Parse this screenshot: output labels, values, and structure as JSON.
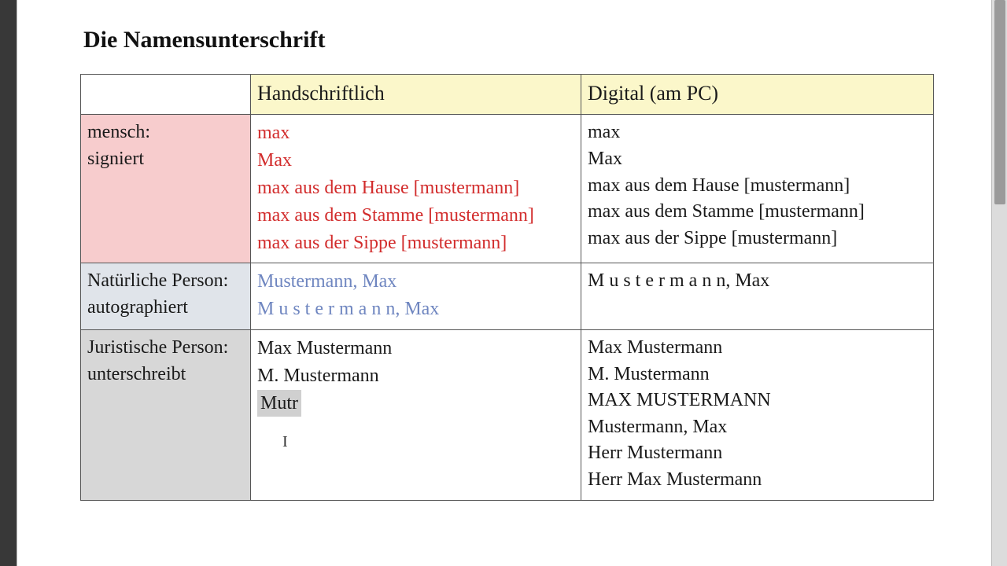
{
  "title": "Die Namensunterschrift",
  "headers": {
    "blank": "",
    "hand": "Handschriftlich",
    "digital": "Digital (am PC)"
  },
  "rows": {
    "mensch": {
      "label_l1": "mensch:",
      "label_l2": "signiert",
      "hand": [
        "max",
        "Max",
        "max aus dem Hause [mustermann]",
        "max aus dem Stamme [mustermann]",
        "max aus der Sippe [mustermann]"
      ],
      "digital": [
        "max",
        "Max",
        "max aus dem Hause [mustermann]",
        "max aus dem Stamme [mustermann]",
        "max aus der Sippe [mustermann]"
      ]
    },
    "nat": {
      "label_l1": "Natürliche Person:",
      "label_l2": "autographiert",
      "hand": [
        "Mustermann, Max",
        "M u s t e r m a n n, Max"
      ],
      "digital": [
        "M u s t e r m a n n, Max"
      ]
    },
    "jur": {
      "label_l1": "Juristische Person:",
      "label_l2": "unterschreibt",
      "hand": [
        "Max Mustermann",
        "M. Mustermann"
      ],
      "hand_hl": "Mutr",
      "digital": [
        "Max Mustermann",
        "M. Mustermann",
        "MAX MUSTERMANN",
        "Mustermann, Max",
        "Herr Mustermann",
        "Herr Max Mustermann"
      ]
    }
  },
  "caret": "I"
}
